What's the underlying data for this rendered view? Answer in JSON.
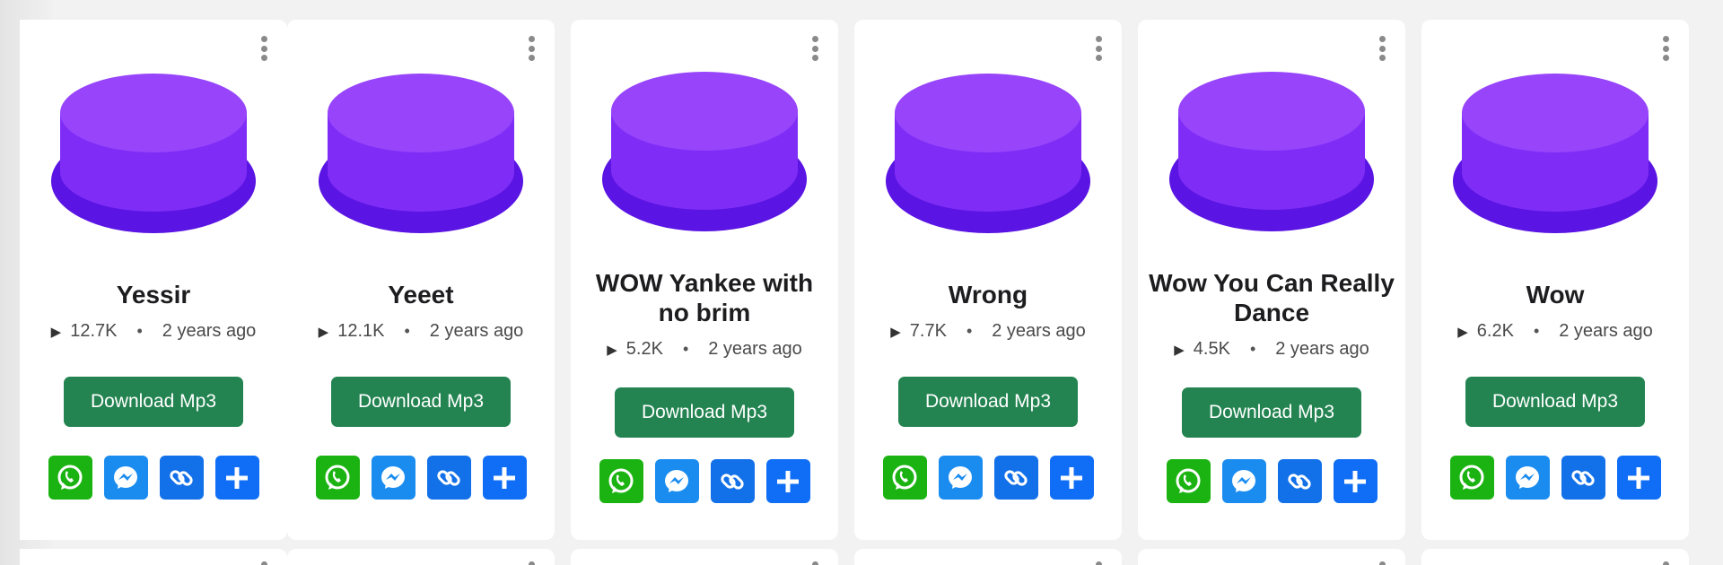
{
  "download_label": "Download Mp3",
  "sounds": [
    {
      "title": "Yessir",
      "plays": "12.7K",
      "age": "2 years ago"
    },
    {
      "title": "Yeeet",
      "plays": "12.1K",
      "age": "2 years ago"
    },
    {
      "title": "WOW Yankee with no brim",
      "plays": "5.2K",
      "age": "2 years ago"
    },
    {
      "title": "Wrong",
      "plays": "7.7K",
      "age": "2 years ago"
    },
    {
      "title": "Wow You Can Really Dance",
      "plays": "4.5K",
      "age": "2 years ago"
    },
    {
      "title": "Wow",
      "plays": "6.2K",
      "age": "2 years ago"
    }
  ],
  "share_icons": [
    "whatsapp-icon",
    "messenger-icon",
    "link-icon",
    "plus-icon"
  ],
  "colors": {
    "button_top": "#9744fb",
    "button_side": "#7f2cf6",
    "button_base": "#5a14e3",
    "download_bg": "#238451",
    "whatsapp": "#1bb312",
    "messenger": "#1a8cf0",
    "link": "#1270e8",
    "plus": "#0f6ef5"
  }
}
